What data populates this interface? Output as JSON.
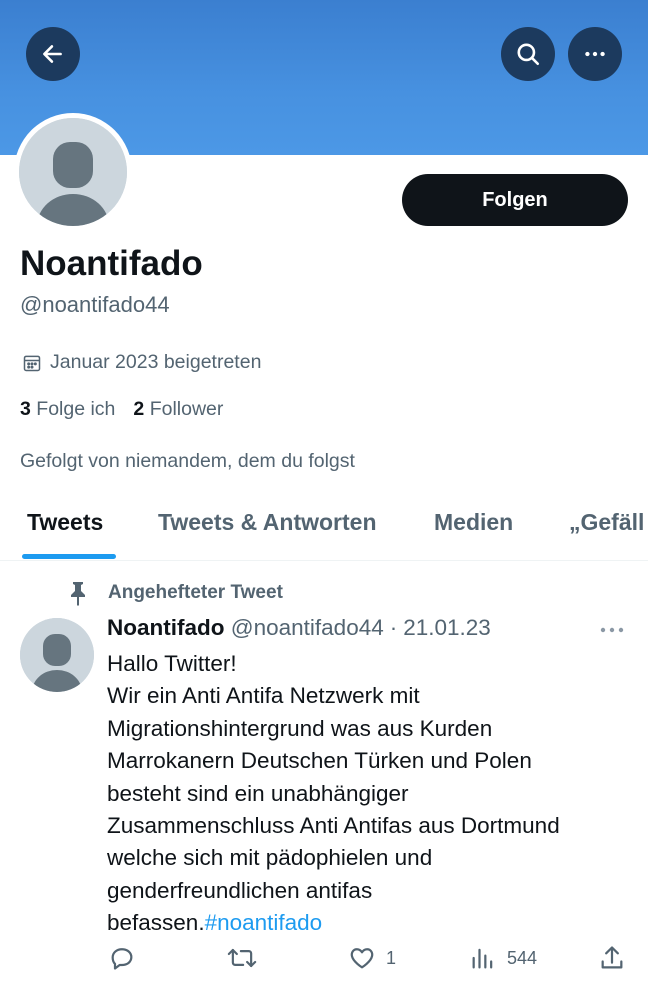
{
  "header": {
    "back_icon": "arrow-left-icon",
    "search_icon": "search-icon",
    "more_icon": "more-horizontal-icon",
    "banner_color": "#4791e0"
  },
  "profile": {
    "display_name": "Noantifado",
    "handle": "@noantifado44",
    "follow_label": "Folgen",
    "joined_icon": "calendar-icon",
    "joined": "Januar 2023 beigetreten",
    "following_count": "3",
    "following_label": "Folge ich",
    "followers_count": "2",
    "followers_label": "Follower",
    "followed_by": "Gefolgt von niemandem, dem du folgst"
  },
  "tabs": [
    {
      "label": "Tweets",
      "active": true
    },
    {
      "label": "Tweets & Antworten",
      "active": false
    },
    {
      "label": "Medien",
      "active": false
    },
    {
      "label": "„Gefäll",
      "active": false
    }
  ],
  "tweet": {
    "pinned_icon": "pin-icon",
    "pinned_label": "Angehefteter Tweet",
    "author_name": "Noantifado",
    "author_handle": "@noantifado44",
    "separator": "·",
    "date": "21.01.23",
    "lines": [
      "Hallo Twitter!",
      "Wir ein Anti Antifa Netzwerk mit",
      "Migrationshintergrund was aus Kurden",
      "Marrokanern Deutschen Türken und Polen",
      "besteht  sind ein unabhängiger",
      "Zusammenschluss  Anti Antifas aus Dortmund",
      "welche  sich mit pädophielen und",
      "genderfreundlichen antifas"
    ],
    "last_line_text": "befassen.",
    "hashtag": "#noantifado",
    "actions": {
      "reply_icon": "reply-icon",
      "retweet_icon": "retweet-icon",
      "like_icon": "heart-icon",
      "like_count": "1",
      "views_icon": "views-icon",
      "views_count": "544",
      "share_icon": "share-icon"
    }
  }
}
